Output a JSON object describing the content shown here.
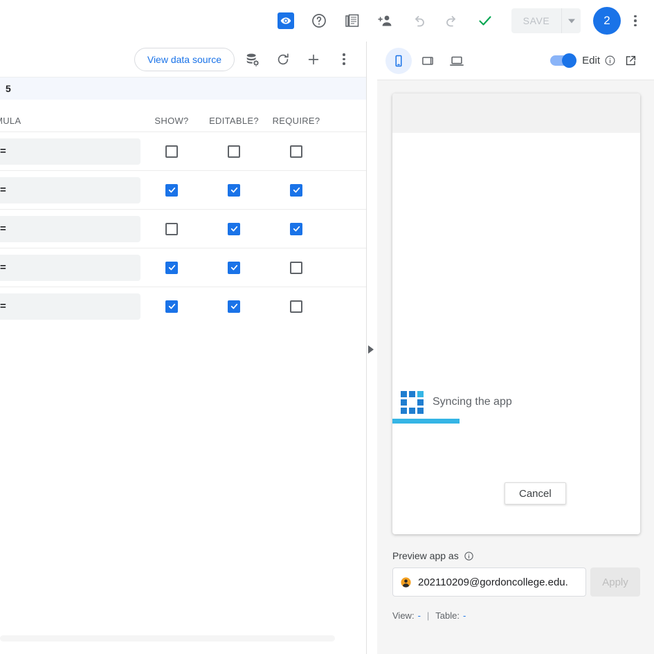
{
  "top_toolbar": {
    "icons": [
      {
        "name": "preview-eye-icon",
        "label": "Preview"
      },
      {
        "name": "help-icon",
        "label": "Help"
      },
      {
        "name": "book-icon",
        "label": "Docs"
      },
      {
        "name": "add-person-icon",
        "label": "Share"
      },
      {
        "name": "undo-icon",
        "label": "Undo"
      },
      {
        "name": "redo-icon",
        "label": "Redo"
      },
      {
        "name": "check-icon",
        "label": "Verified"
      }
    ],
    "save_label": "SAVE",
    "avatar_text": "2",
    "accent_color": "#1a73e8",
    "check_color": "#00a651"
  },
  "left_panel": {
    "view_data_source_label": "View data source",
    "header_icons": [
      {
        "name": "database-settings-icon"
      },
      {
        "name": "refresh-icon"
      },
      {
        "name": "add-icon"
      },
      {
        "name": "more-vert-icon"
      }
    ],
    "selection_count": "5",
    "table": {
      "headers": {
        "formula": "ORMULA",
        "show": "SHOW?",
        "editable": "EDITABLE?",
        "require": "REQUIRE?"
      },
      "rows": [
        {
          "formula": "=",
          "show": false,
          "editable": false,
          "require": false
        },
        {
          "formula": "=",
          "show": true,
          "editable": true,
          "require": true
        },
        {
          "formula": "=",
          "show": false,
          "editable": true,
          "require": true
        },
        {
          "formula": "=",
          "show": true,
          "editable": true,
          "require": false
        },
        {
          "formula": "=",
          "show": true,
          "editable": true,
          "require": false
        }
      ]
    }
  },
  "right_panel": {
    "devices": [
      {
        "name": "phone-device-icon",
        "label": "Phone",
        "active": true
      },
      {
        "name": "tablet-device-icon",
        "label": "Tablet",
        "active": false
      },
      {
        "name": "laptop-device-icon",
        "label": "Laptop",
        "active": false
      }
    ],
    "edit_toggle_label": "Edit",
    "edit_toggle_on": true,
    "open_external_label": "Open in new tab",
    "app_preview": {
      "sync_text": "Syncing the app",
      "progress_percent": 27,
      "cancel_label": "Cancel",
      "spinner_color": "#1f7ed0",
      "spinner_accent_color": "#35b5e5",
      "progress_color": "#35b5e5"
    },
    "preview_as": {
      "label": "Preview app as",
      "email": "202110209@gordoncollege.edu.",
      "apply_label": "Apply",
      "status_view_label": "View:",
      "status_view_value": "-",
      "status_separator": "|",
      "status_table_label": "Table:",
      "status_table_value": "-"
    }
  }
}
